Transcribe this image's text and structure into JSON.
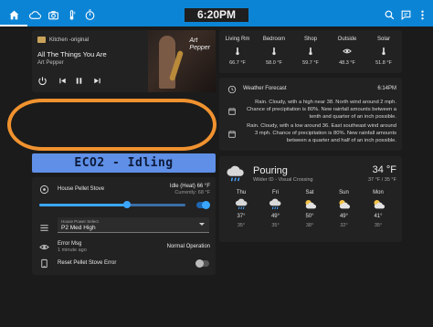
{
  "topbar": {
    "clock": "6:20PM",
    "left_icons": [
      "home-icon",
      "cloud-icon",
      "camera-icon",
      "thermostat-icon",
      "timer-icon"
    ],
    "right_icons": [
      "search-icon",
      "chat-icon",
      "more-vert-icon"
    ],
    "accent": "#0b84d6"
  },
  "media": {
    "source": "Kitchen -original",
    "track": "All The Things You Are",
    "artist": "Art Pepper",
    "art_text_line1": "Art",
    "art_text_line2": "Pepper"
  },
  "banner": {
    "text": "ECO2 - Idling",
    "color": "#5f8fe6"
  },
  "stove": {
    "name": "House Pellet Stove",
    "status": "Idle (Heat) 66 °F",
    "current": "Currently: 68 °F",
    "setpoint_fraction": 0.6,
    "select_label": "House Power Select",
    "select_value": "P2 Med High",
    "error_name": "Error Msg",
    "error_time": "1 minute ago",
    "error_value": "Normal Operation",
    "reset_label": "Reset Pellet Stove Error",
    "heat_on": true,
    "reset_on": false
  },
  "temps": [
    {
      "name": "Living Rm",
      "value": "66.7 °F",
      "icon": "thermometer-icon"
    },
    {
      "name": "Bedroom",
      "value": "58.0 °F",
      "icon": "thermometer-icon"
    },
    {
      "name": "Shop",
      "value": "59.7 °F",
      "icon": "thermometer-icon"
    },
    {
      "name": "Outside",
      "value": "48.3 °F",
      "icon": "eye-icon"
    },
    {
      "name": "Solar",
      "value": "51.8 °F",
      "icon": "thermometer-icon"
    }
  ],
  "forecast_text": {
    "label": "Weather Forecast",
    "time": "6:14PM",
    "para1": "Rain. Cloudy, with a high near 38. North wind around 2 mph. Chance of precipitation is 80%. New rainfall amounts between a tenth and quarter of an inch possible.",
    "para2": "Rain. Cloudy, with a low around 36. East southeast wind around 3 mph. Chance of precipitation is 80%. New rainfall amounts between a quarter and half of an inch possible."
  },
  "weather": {
    "condition": "Pouring",
    "location": "Wilder ID - Visual Crossing",
    "temp": "34 °F",
    "hilo": "37 °F / 35 °F",
    "days": [
      {
        "name": "Thu",
        "hi": "37°",
        "lo": "35°",
        "icon": "rain-cloud-icon"
      },
      {
        "name": "Fri",
        "hi": "49°",
        "lo": "35°",
        "icon": "rain-cloud-icon"
      },
      {
        "name": "Sat",
        "hi": "50°",
        "lo": "38°",
        "icon": "partly-cloudy-icon"
      },
      {
        "name": "Sun",
        "hi": "49°",
        "lo": "32°",
        "icon": "partly-cloudy-icon"
      },
      {
        "name": "Mon",
        "hi": "41°",
        "lo": "35°",
        "icon": "partly-cloudy-icon"
      }
    ]
  }
}
